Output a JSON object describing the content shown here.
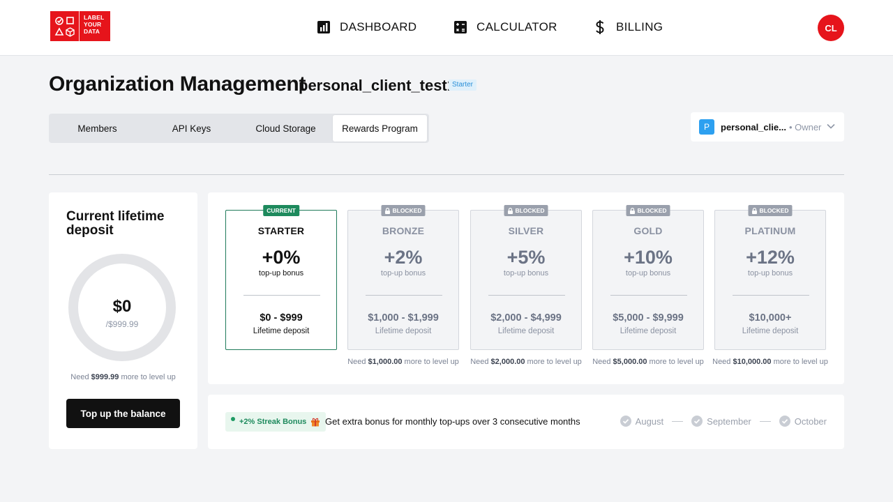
{
  "logo": {
    "lines": [
      "LABEL",
      "YOUR",
      "DATA"
    ]
  },
  "nav": {
    "dashboard": "DASHBOARD",
    "calculator": "CALCULATOR",
    "billing": "BILLING"
  },
  "user": {
    "initials": "CL"
  },
  "header": {
    "title": "Organization Management",
    "org_name": "personal_client_test1",
    "plan": "Starter"
  },
  "tabs": [
    {
      "label": "Members",
      "active": false
    },
    {
      "label": "API Keys",
      "active": false
    },
    {
      "label": "Cloud Storage",
      "active": false
    },
    {
      "label": "Rewards Program",
      "active": true
    }
  ],
  "org_select": {
    "initial": "P",
    "name": "personal_clie...",
    "role": "• Owner"
  },
  "deposit": {
    "title": "Current lifetime deposit",
    "value": "$0",
    "max": "/$999.99",
    "need_prefix": "Need ",
    "need_amount": "$999.99",
    "need_suffix": " more to level up",
    "button": "Top up the balance",
    "progress": 0
  },
  "tiers": [
    {
      "flag": "CURRENT",
      "name": "STARTER",
      "bonus": "+0%",
      "bonus_label": "top-up bonus",
      "range": "$0 - $999",
      "range_label": "Lifetime deposit",
      "status": "current"
    },
    {
      "flag": "BLOCKED",
      "name": "BRONZE",
      "bonus": "+2%",
      "bonus_label": "top-up bonus",
      "range": "$1,000 - $1,999",
      "range_label": "Lifetime deposit",
      "status": "blocked",
      "need_amount": "$1,000.00"
    },
    {
      "flag": "BLOCKED",
      "name": "SILVER",
      "bonus": "+5%",
      "bonus_label": "top-up bonus",
      "range": "$2,000 - $4,999",
      "range_label": "Lifetime deposit",
      "status": "blocked",
      "need_amount": "$2,000.00"
    },
    {
      "flag": "BLOCKED",
      "name": "GOLD",
      "bonus": "+10%",
      "bonus_label": "top-up bonus",
      "range": "$5,000 - $9,999",
      "range_label": "Lifetime deposit",
      "status": "blocked",
      "need_amount": "$5,000.00"
    },
    {
      "flag": "BLOCKED",
      "name": "PLATINUM",
      "bonus": "+12%",
      "bonus_label": "top-up bonus",
      "range": "$10,000+",
      "range_label": "Lifetime deposit",
      "status": "blocked",
      "need_amount": "$10,000.00"
    }
  ],
  "tier_need": {
    "prefix": "Need ",
    "suffix": " more to level up"
  },
  "streak": {
    "badge": "+2% Streak Bonus",
    "text": "Get extra bonus for monthly top-ups over 3 consecutive months",
    "months": [
      "August",
      "September",
      "October"
    ]
  },
  "colors": {
    "brand_red": "#e6141b",
    "current_green": "#1e8a5d",
    "blocked_gray": "#9aa0ac"
  }
}
